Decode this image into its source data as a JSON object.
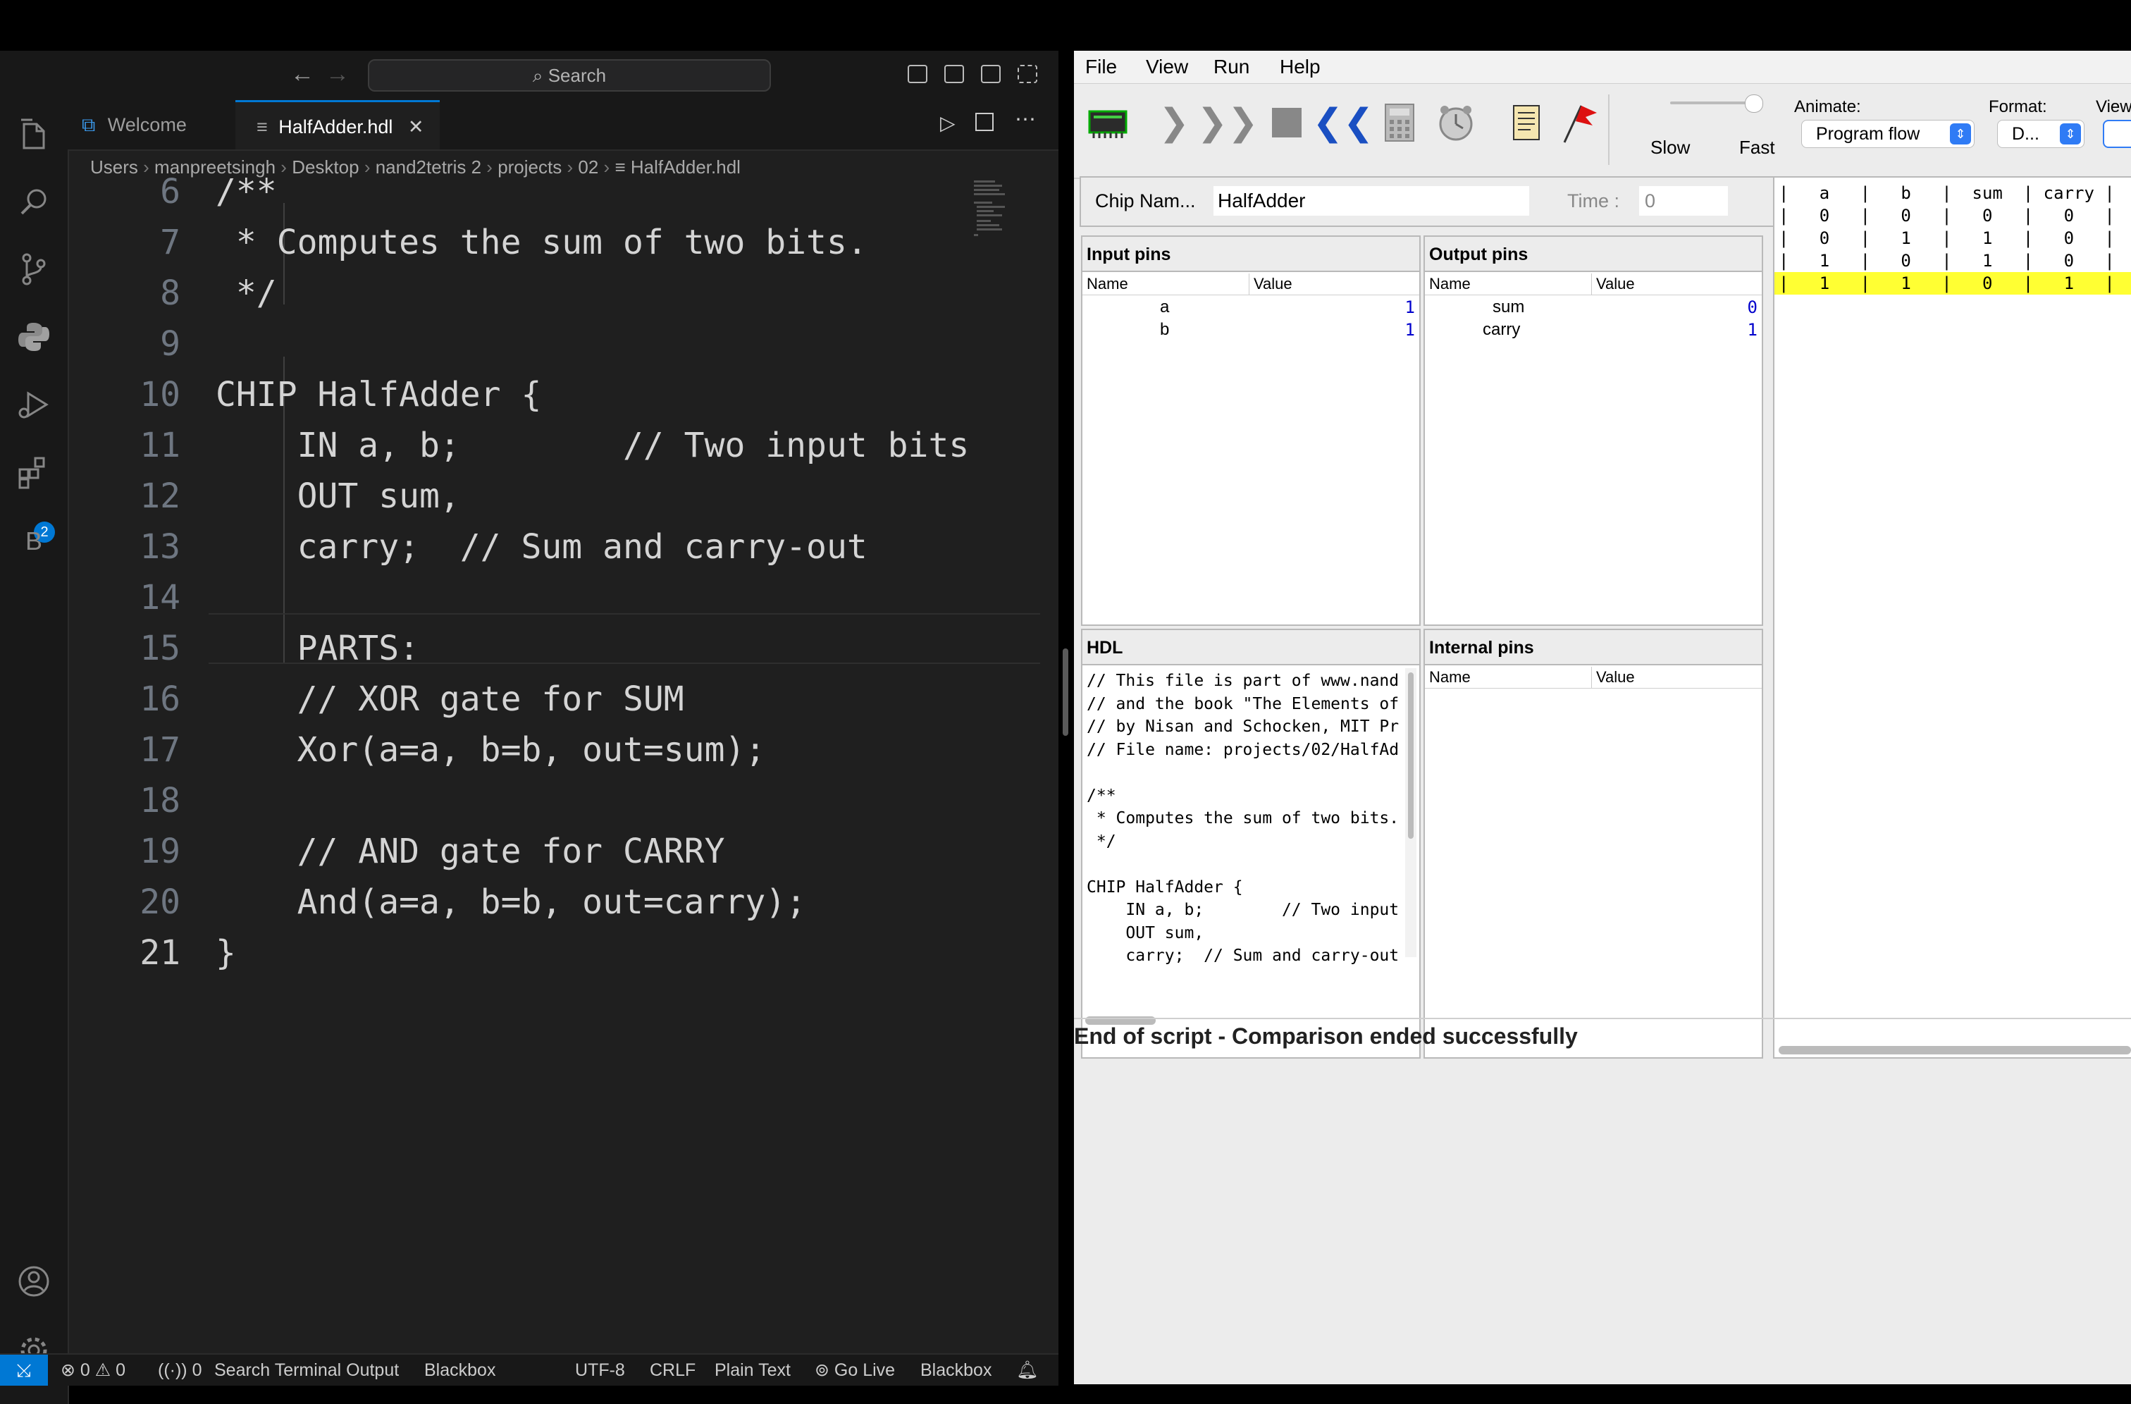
{
  "vscode": {
    "search_placeholder": "Search",
    "tabs": [
      {
        "label": "Welcome"
      },
      {
        "label": "HalfAdder.hdl"
      }
    ],
    "breadcrumb": [
      "Users",
      "manpreetsingh",
      "Desktop",
      "nand2tetris 2",
      "projects",
      "02",
      "HalfAdder.hdl"
    ],
    "extensions_badge": "2",
    "blackbox_letter": "B",
    "code_lines": [
      {
        "num": "6",
        "text": "/**"
      },
      {
        "num": "7",
        "text": " * Computes the sum of two bits."
      },
      {
        "num": "8",
        "text": " */"
      },
      {
        "num": "9",
        "text": ""
      },
      {
        "num": "10",
        "text": "CHIP HalfAdder {"
      },
      {
        "num": "11",
        "text": "    IN a, b;        // Two input bits"
      },
      {
        "num": "12",
        "text": "    OUT sum,"
      },
      {
        "num": "13",
        "text": "    carry;  // Sum and carry-out"
      },
      {
        "num": "14",
        "text": ""
      },
      {
        "num": "15",
        "text": "    PARTS:"
      },
      {
        "num": "16",
        "text": "    // XOR gate for SUM"
      },
      {
        "num": "17",
        "text": "    Xor(a=a, b=b, out=sum);"
      },
      {
        "num": "18",
        "text": ""
      },
      {
        "num": "19",
        "text": "    // AND gate for CARRY"
      },
      {
        "num": "20",
        "text": "    And(a=a, b=b, out=carry);"
      },
      {
        "num": "21",
        "text": "}"
      }
    ],
    "status": {
      "errors": "0",
      "warnings": "0",
      "ports": "0",
      "search_terminal": "Search Terminal Output",
      "blackbox_left": "Blackbox",
      "encoding": "UTF-8",
      "eol": "CRLF",
      "language": "Plain Text",
      "go_live": "Go Live",
      "blackbox_right": "Blackbox"
    }
  },
  "simulator": {
    "menu": [
      "File",
      "View",
      "Run",
      "Help"
    ],
    "speed_slow": "Slow",
    "speed_fast": "Fast",
    "animate_label": "Animate:",
    "animate_value": "Program flow",
    "format_label": "Format:",
    "format_value": "D...",
    "view_label": "View",
    "chip_name_label": "Chip Nam...",
    "chip_name_value": "HalfAdder",
    "time_label": "Time :",
    "time_value": "0",
    "input_pins_title": "Input pins",
    "output_pins_title": "Output pins",
    "hdl_title": "HDL",
    "internal_pins_title": "Internal pins",
    "col_name": "Name",
    "col_value": "Value",
    "input_pins": [
      {
        "name": "a",
        "value": "1"
      },
      {
        "name": "b",
        "value": "1"
      }
    ],
    "output_pins": [
      {
        "name": "sum",
        "value": "0"
      },
      {
        "name": "carry",
        "value": "1"
      }
    ],
    "hdl_lines": [
      "// This file is part of www.nand",
      "// and the book \"The Elements of",
      "// by Nisan and Schocken, MIT Pr",
      "// File name: projects/02/HalfAd",
      "",
      "/**",
      " * Computes the sum of two bits.",
      " */",
      "",
      "CHIP HalfAdder {",
      "    IN a, b;        // Two input",
      "    OUT sum,",
      "    carry;  // Sum and carry-out"
    ],
    "compare_lines": [
      "|   a   |   b   |  sum  | carry |",
      "|   0   |   0   |   0   |   0   |",
      "|   0   |   1   |   1   |   0   |",
      "|   1   |   0   |   1   |   0   |",
      "|   1   |   1   |   0   |   1   |"
    ],
    "status_message": "End of script - Comparison ended successfully"
  }
}
